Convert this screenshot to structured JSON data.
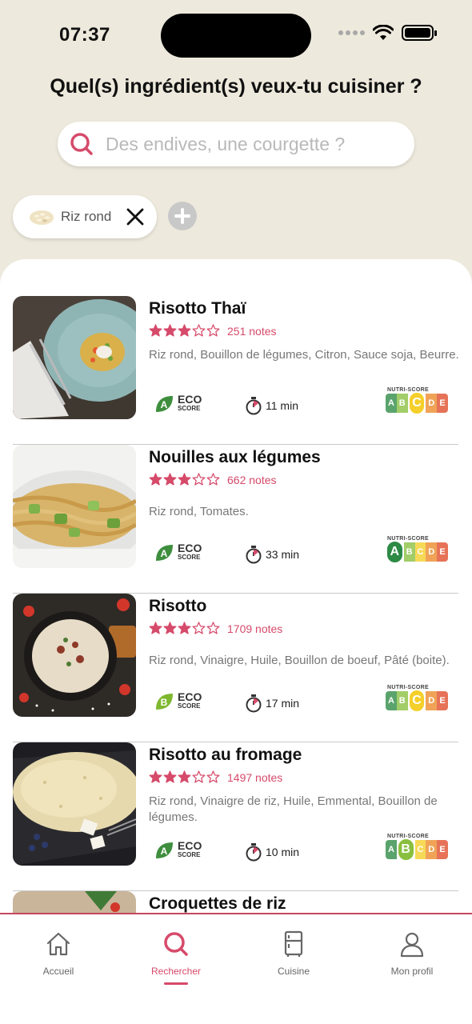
{
  "status_bar": {
    "time": "07:37"
  },
  "header": {
    "title": "Quel(s) ingrédient(s) veux-tu cuisiner ?"
  },
  "search": {
    "placeholder": "Des endives, une courgette ?",
    "icon": "search-icon"
  },
  "selected_ingredients": [
    {
      "label": "Riz rond",
      "icon": "rice-icon"
    }
  ],
  "colors": {
    "accent": "#d64a6a",
    "background": "#ede9dc",
    "eco_a": "#3e8e3e",
    "eco_b": "#7fb82f"
  },
  "nutri_score_title": "NUTRI-SCORE",
  "eco_score": {
    "line1": "ECO",
    "line2": "SCORE"
  },
  "recipes": [
    {
      "title": "Risotto Thaï",
      "rating": 3,
      "notes": "251 notes",
      "ingredients": "Riz rond, Bouillon de légumes, Citron, Sauce soja, Beurre.",
      "eco_grade": "A",
      "duration": "11 min",
      "nutri_grade": "C"
    },
    {
      "title": "Nouilles aux légumes",
      "rating": 3,
      "notes": "662 notes",
      "ingredients": "Riz rond, Tomates.",
      "eco_grade": "A",
      "duration": "33 min",
      "nutri_grade": "A"
    },
    {
      "title": "Risotto",
      "rating": 3,
      "notes": "1709 notes",
      "ingredients": "Riz rond, Vinaigre, Huile, Bouillon de boeuf, Pâté (boite).",
      "eco_grade": "B",
      "duration": "17 min",
      "nutri_grade": "C"
    },
    {
      "title": "Risotto au fromage",
      "rating": 3,
      "notes": "1497 notes",
      "ingredients": "Riz rond, Vinaigre de riz, Huile, Emmental, Bouillon de légumes.",
      "eco_grade": "A",
      "duration": "10 min",
      "nutri_grade": "B"
    },
    {
      "title": "Croquettes de riz"
    }
  ],
  "nutri_grades": [
    "A",
    "B",
    "C",
    "D",
    "E"
  ],
  "nutri_colors": [
    "#2d8a45",
    "#89bf3e",
    "#f5cf2a",
    "#ec8a28",
    "#e04c2a"
  ],
  "tabs": [
    {
      "label": "Accueil",
      "icon": "home-icon"
    },
    {
      "label": "Rechercher",
      "icon": "search-icon",
      "active": true
    },
    {
      "label": "Cuisine",
      "icon": "fridge-icon"
    },
    {
      "label": "Mon profil",
      "icon": "profile-icon"
    }
  ]
}
